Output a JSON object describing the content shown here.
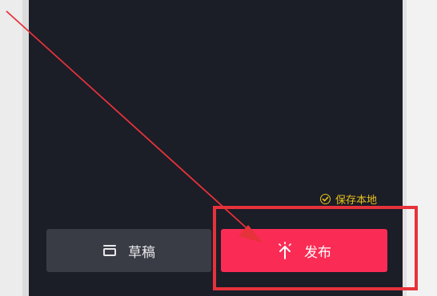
{
  "editor": {
    "save_local_label": "保存本地",
    "save_local_icon": "check-circle-icon"
  },
  "actions": {
    "draft_label": "草稿",
    "draft_icon": "draft-box-icon",
    "publish_label": "发布",
    "publish_icon": "upload-arrow-icon"
  },
  "colors": {
    "screen_bg": "#1b1d27",
    "draft_bg": "#3a3c45",
    "publish_bg": "#fa2c55",
    "accent_yellow": "#e8c21a",
    "annotation_red": "#e6323a"
  }
}
